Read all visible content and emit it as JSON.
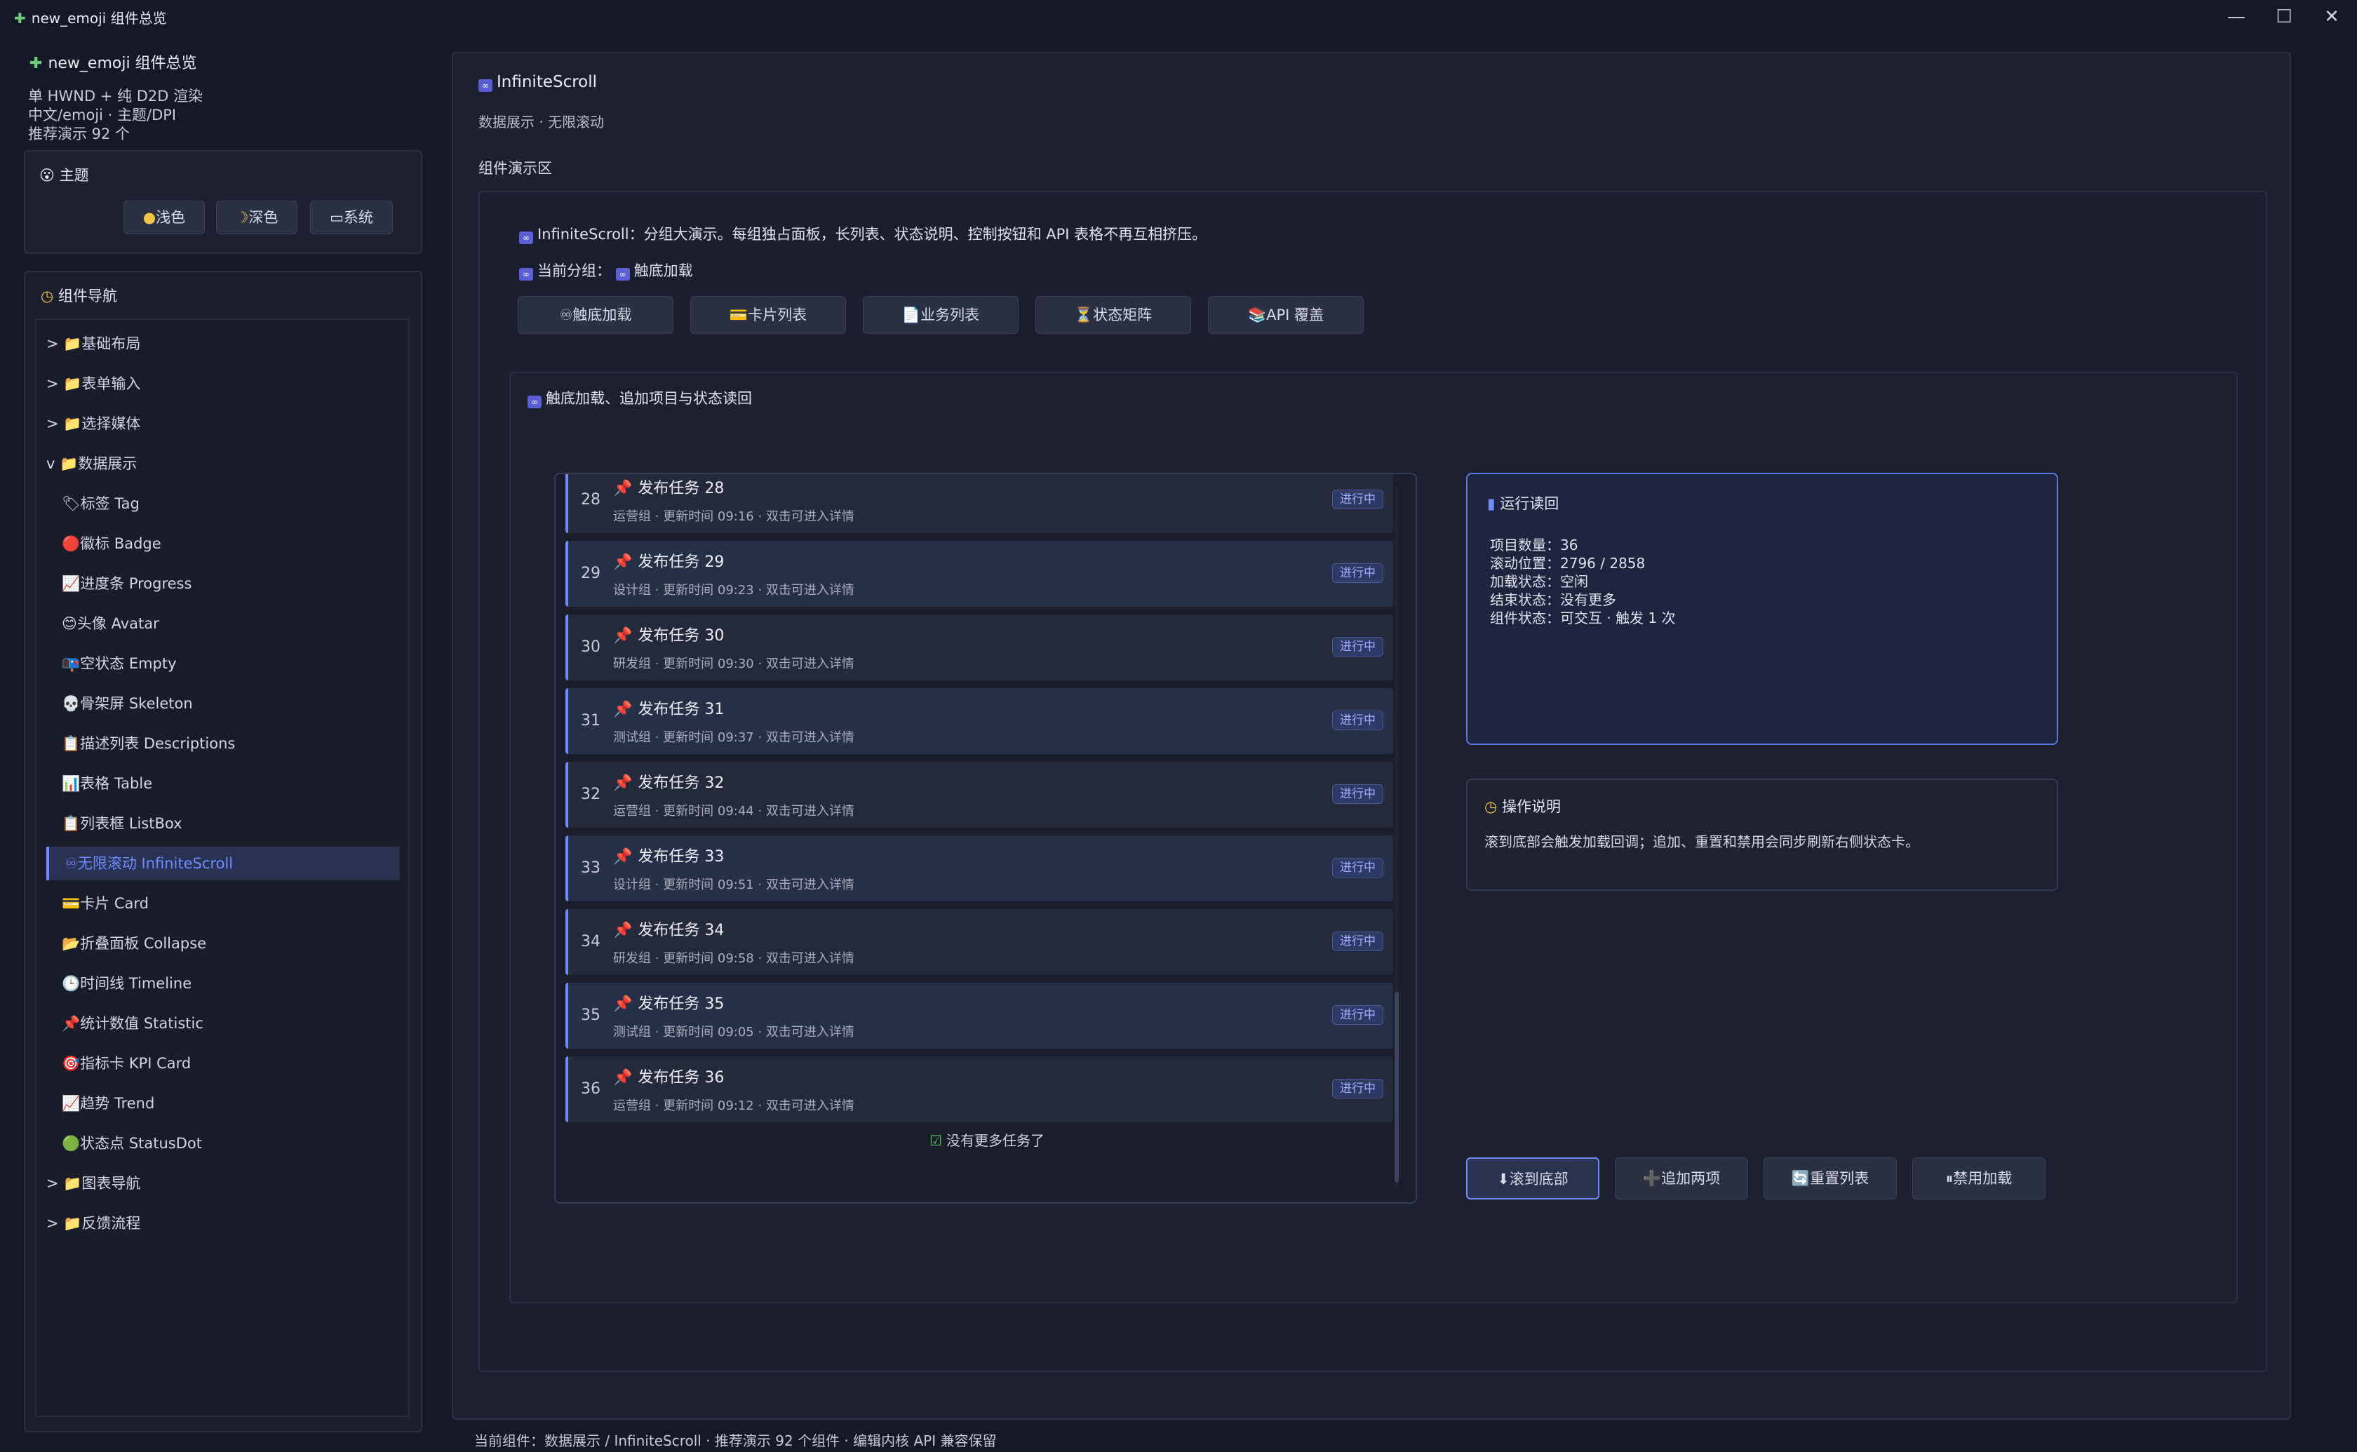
{
  "window": {
    "title": "new_emoji 组件总览",
    "title_icon": "puzzle-icon",
    "controls": [
      "minimize",
      "maximize",
      "close"
    ]
  },
  "sidebar": {
    "brand": "new_emoji 组件总览",
    "info_lines": [
      "单 HWND + 纯 D2D 渲染",
      "中文/emoji · 主题/DPI",
      "推荐演示 92 个"
    ],
    "theme": {
      "label": "主题",
      "buttons": [
        "浅色",
        "深色",
        "系统"
      ]
    },
    "nav": {
      "label": "组件导航",
      "items": [
        {
          "label": "> 📁基础布局",
          "indent": 0
        },
        {
          "label": "> 📁表单输入",
          "indent": 0
        },
        {
          "label": "> 📁选择媒体",
          "indent": 0
        },
        {
          "label": "v 📁数据展示",
          "indent": 0
        },
        {
          "label": "🏷标签 Tag",
          "indent": 1
        },
        {
          "label": "🔴徽标 Badge",
          "indent": 1
        },
        {
          "label": "📈进度条 Progress",
          "indent": 1
        },
        {
          "label": "😊头像 Avatar",
          "indent": 1
        },
        {
          "label": "📭空状态 Empty",
          "indent": 1
        },
        {
          "label": "💀骨架屏 Skeleton",
          "indent": 1
        },
        {
          "label": "📋描述列表 Descriptions",
          "indent": 1
        },
        {
          "label": "📊表格 Table",
          "indent": 1
        },
        {
          "label": "📋列表框 ListBox",
          "indent": 1
        },
        {
          "label": "♾无限滚动 InfiniteScroll",
          "indent": 1,
          "active": true
        },
        {
          "label": "💳卡片 Card",
          "indent": 1
        },
        {
          "label": "📂折叠面板 Collapse",
          "indent": 1
        },
        {
          "label": "🕒时间线 Timeline",
          "indent": 1
        },
        {
          "label": "📌统计数值 Statistic",
          "indent": 1
        },
        {
          "label": "🎯指标卡 KPI Card",
          "indent": 1
        },
        {
          "label": "📈趋势 Trend",
          "indent": 1
        },
        {
          "label": "🟢状态点 StatusDot",
          "indent": 1
        },
        {
          "label": "> 📁图表导航",
          "indent": 0
        },
        {
          "label": "> 📁反馈流程",
          "indent": 0
        }
      ]
    }
  },
  "main": {
    "title": "InfiniteScroll",
    "subtitle": "数据展示 · 无限滚动",
    "demo_label": "组件演示区",
    "intro": "InfiniteScroll：分组大演示。每组独占面板，长列表、状态说明、控制按钮和 API 表格不再互相挤压。",
    "current_group_prefix": "当前分组：",
    "current_group": "触底加载",
    "group_buttons": [
      "♾触底加载",
      "💳卡片列表",
      "📄业务列表",
      "⏳状态矩阵",
      "📚API 覆盖"
    ],
    "panel_title": "触底加载、追加项目与状态读回",
    "list": {
      "rows": [
        {
          "num": "28",
          "title": "发布任务 28",
          "meta": "运营组 · 更新时间 09:16 · 双击可进入详情",
          "badge": "进行中"
        },
        {
          "num": "29",
          "title": "发布任务 29",
          "meta": "设计组 · 更新时间 09:23 · 双击可进入详情",
          "badge": "进行中"
        },
        {
          "num": "30",
          "title": "发布任务 30",
          "meta": "研发组 · 更新时间 09:30 · 双击可进入详情",
          "badge": "进行中"
        },
        {
          "num": "31",
          "title": "发布任务 31",
          "meta": "测试组 · 更新时间 09:37 · 双击可进入详情",
          "badge": "进行中"
        },
        {
          "num": "32",
          "title": "发布任务 32",
          "meta": "运营组 · 更新时间 09:44 · 双击可进入详情",
          "badge": "进行中"
        },
        {
          "num": "33",
          "title": "发布任务 33",
          "meta": "设计组 · 更新时间 09:51 · 双击可进入详情",
          "badge": "进行中"
        },
        {
          "num": "34",
          "title": "发布任务 34",
          "meta": "研发组 · 更新时间 09:58 · 双击可进入详情",
          "badge": "进行中"
        },
        {
          "num": "35",
          "title": "发布任务 35",
          "meta": "测试组 · 更新时间 09:05 · 双击可进入详情",
          "badge": "进行中"
        },
        {
          "num": "36",
          "title": "发布任务 36",
          "meta": "运营组 · 更新时间 09:12 · 双击可进入详情",
          "badge": "进行中"
        }
      ],
      "end_text": "没有更多任务了"
    },
    "run_card": {
      "title": "运行读回",
      "lines": [
        "项目数量：36",
        "滚动位置：2796 / 2858",
        "加载状态：空闲",
        "结束状态：没有更多",
        "组件状态：可交互 · 触发 1 次"
      ]
    },
    "help_card": {
      "title": "操作说明",
      "text": "滚到底部会触发加载回调；追加、重置和禁用会同步刷新右侧状态卡。"
    },
    "actions": [
      "⬇滚到底部",
      "➕追加两项",
      "🔄重置列表",
      "⏸禁用加载"
    ]
  },
  "status_bar": "当前组件：数据展示 / InfiniteScroll · 推荐演示 92 个组件 · 编辑内核 API 兼容保留",
  "colors": {
    "background": "#151826",
    "panel": "#1c2031",
    "accent": "#6f8cff",
    "badge": "#2e3a66"
  }
}
